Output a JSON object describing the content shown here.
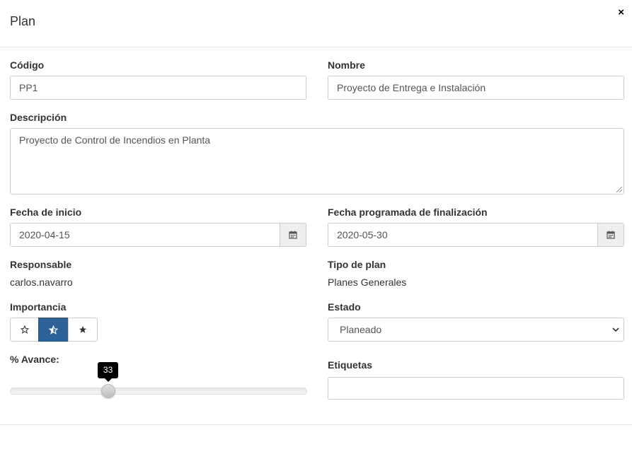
{
  "modal": {
    "title": "Plan",
    "close_glyph": "×"
  },
  "fields": {
    "codigo": {
      "label": "Código",
      "value": "PP1"
    },
    "nombre": {
      "label": "Nombre",
      "value": "Proyecto de Entrega e Instalación"
    },
    "descripcion": {
      "label": "Descripción",
      "value": "Proyecto de Control de Incendios en Planta"
    },
    "fecha_inicio": {
      "label": "Fecha de inicio",
      "value": "2020-04-15",
      "icon": "calendar-icon"
    },
    "fecha_fin": {
      "label": "Fecha programada de finalización",
      "value": "2020-05-30",
      "icon": "calendar-icon"
    },
    "responsable": {
      "label": "Responsable",
      "value": "carlos.navarro"
    },
    "tipo_plan": {
      "label": "Tipo de plan",
      "value": "Planes Generales"
    },
    "importancia": {
      "label": "Importancia",
      "selected_index": 1,
      "options": [
        "star-empty-icon",
        "star-half-icon",
        "star-full-icon"
      ],
      "accent_color": "#2e6296"
    },
    "estado": {
      "label": "Estado",
      "value": "Planeado"
    },
    "avance": {
      "label": "% Avance:",
      "value": "33",
      "min": 0,
      "max": 100,
      "fraction": 0.33
    },
    "etiquetas": {
      "label": "Etiquetas",
      "value": ""
    }
  }
}
